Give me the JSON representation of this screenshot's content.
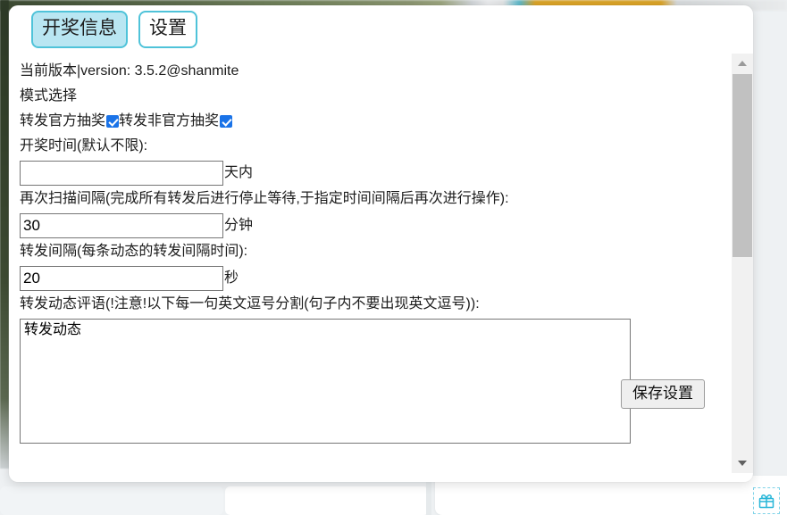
{
  "panel": {
    "tabs": [
      {
        "label": "开奖信息",
        "active": true
      },
      {
        "label": "设置",
        "active": false
      }
    ],
    "version_line": "当前版本|version: 3.5.2@shanmite",
    "mode_section_label": "模式选择",
    "checkboxes": [
      {
        "label": "转发官方抽奖",
        "checked": true
      },
      {
        "label": "转发非官方抽奖",
        "checked": true
      }
    ],
    "fields": [
      {
        "label": "开奖时间(默认不限):",
        "value": "",
        "placeholder": "",
        "unit": "天内"
      },
      {
        "label": "再次扫描间隔(完成所有转发后进行停止等待,于指定时间间隔后再次进行操作):",
        "value": "30",
        "placeholder": "",
        "unit": "分钟"
      },
      {
        "label": "转发间隔(每条动态的转发间隔时间):",
        "value": "20",
        "placeholder": "",
        "unit": "秒"
      }
    ],
    "textarea": {
      "label": "转发动态评语(!注意!以下每一句英文逗号分割(句子内不要出现英文逗号)):",
      "value": "转发动态",
      "placeholder": ""
    },
    "save_button_label": "保存设置",
    "scrollbar": {
      "up_arrow": "scroll-up-arrow",
      "down_arrow": "scroll-down-arrow"
    }
  },
  "background": {
    "gift_icon_name": "gift-icon"
  },
  "colors": {
    "tab_border": "#4fc3d9",
    "tab_active_fill": "#b9e6f2",
    "checkbox_checked": "#1a73e8",
    "gift_icon": "#29b6d8",
    "panel_bg": "#ffffff",
    "scrollbar_thumb": "#c1c1c1"
  }
}
